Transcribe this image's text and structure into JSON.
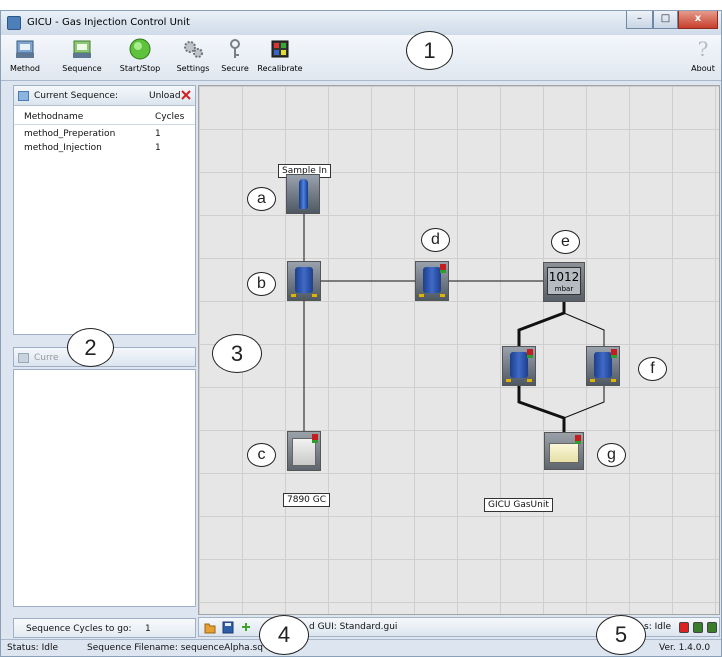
{
  "window": {
    "title": "GICU - Gas Injection Control Unit",
    "minimize": "–",
    "maximize": "□",
    "close": "x"
  },
  "toolbar": {
    "method": "Method",
    "sequence": "Sequence",
    "start_stop": "Start/Stop",
    "settings": "Settings",
    "secure": "Secure",
    "recalibrate": "Recalibrate",
    "about": "About"
  },
  "sequence_panel": {
    "title": "Current Sequence:",
    "unload": "Unload",
    "col_methodname": "Methodname",
    "col_cycles": "Cycles",
    "rows": [
      {
        "name": "method_Preperation",
        "cycles": "1"
      },
      {
        "name": "method_Injection",
        "cycles": "1"
      }
    ],
    "second_header": "Curre",
    "cycles_to_go_label": "Sequence Cycles to go:",
    "cycles_to_go_value": "1"
  },
  "diagram": {
    "sample_in": "Sample In",
    "gc_label": "7890 GC",
    "gasunit_label": "GICU GasUnit",
    "pressure_value": "1012",
    "pressure_unit": "mbar"
  },
  "callouts": {
    "c1": "1",
    "c2": "2",
    "c3": "3",
    "c4": "4",
    "c5": "5",
    "a": "a",
    "b": "b",
    "c": "c",
    "d": "d",
    "e": "e",
    "f": "f",
    "g": "g"
  },
  "bottom_bar": {
    "loaded_gui": "d GUI:  Standard.gui",
    "status_prefix": "s:  Idle"
  },
  "status_bar": {
    "status": "Status:  Idle",
    "filename": "Sequence Filename:  sequenceAlpha.sq",
    "version": "Ver. 1.4.0.0"
  },
  "colors": {
    "accent": "#1e3f8a",
    "close": "#c7402b",
    "grid": "#e6e6e6"
  }
}
